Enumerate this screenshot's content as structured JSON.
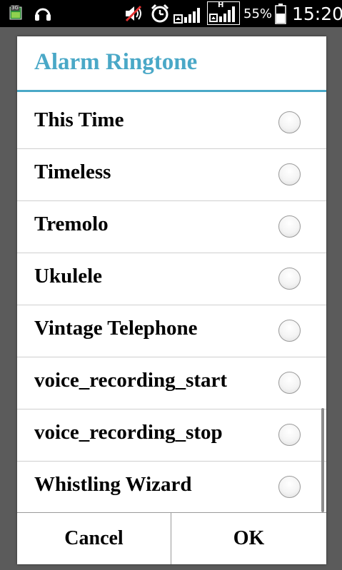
{
  "status_bar": {
    "network_badge": "3G",
    "network_type": "H",
    "battery_percent": "55%",
    "time": "15:20",
    "icons": [
      "notification-icon",
      "headphones-icon",
      "muted-volume-icon",
      "alarm-icon",
      "signal-icon",
      "data-signal-icon",
      "battery-icon"
    ]
  },
  "dialog": {
    "title": "Alarm Ringtone",
    "accent_color": "#4aa8c7",
    "items": [
      {
        "label": "This Time",
        "selected": false
      },
      {
        "label": "Timeless",
        "selected": false
      },
      {
        "label": "Tremolo",
        "selected": false
      },
      {
        "label": "Ukulele",
        "selected": false
      },
      {
        "label": "Vintage Telephone",
        "selected": false
      },
      {
        "label": "voice_recording_start",
        "selected": false
      },
      {
        "label": "voice_recording_stop",
        "selected": false
      },
      {
        "label": "Whistling Wizard",
        "selected": false
      }
    ],
    "cancel_label": "Cancel",
    "ok_label": "OK"
  }
}
